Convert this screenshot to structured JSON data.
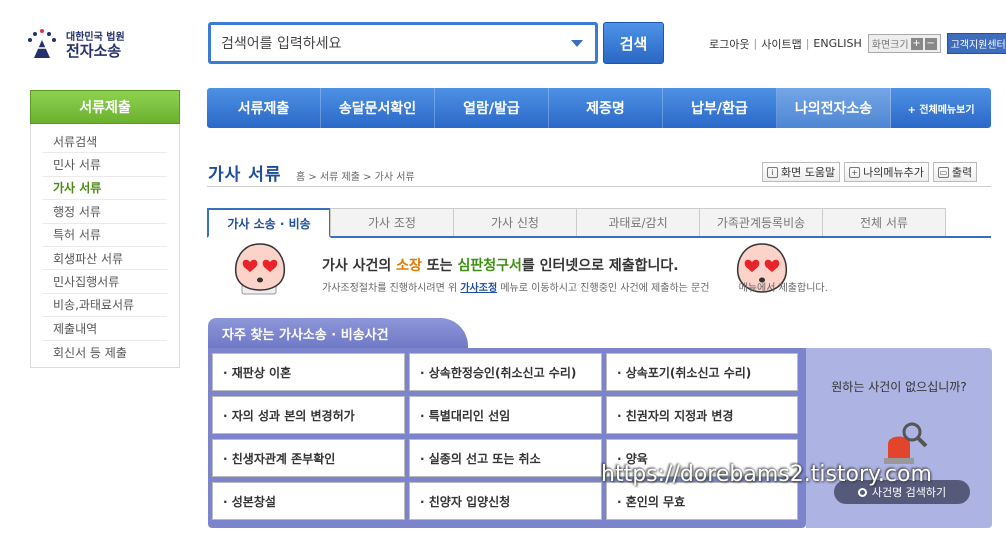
{
  "header": {
    "logo_small": "대한민국 법원",
    "logo_big": "전자소송",
    "search_placeholder": "검색어를 입력하세요",
    "search_button": "검색",
    "util": {
      "logout": "로그아웃",
      "sitemap": "사이트맵",
      "english": "ENGLISH",
      "font_size": "화면크기",
      "plus": "+",
      "minus": "−",
      "support": "고객지원센터"
    }
  },
  "sidebar": {
    "title": "서류제출",
    "items": [
      {
        "label": "서류검색"
      },
      {
        "label": "민사 서류"
      },
      {
        "label": "가사 서류"
      },
      {
        "label": "행정 서류"
      },
      {
        "label": "특허 서류"
      },
      {
        "label": "회생파산 서류"
      },
      {
        "label": "민사집행서류"
      },
      {
        "label": "비송,과태료서류"
      },
      {
        "label": "제출내역"
      },
      {
        "label": "회신서 등 제출"
      }
    ],
    "active_index": 2
  },
  "gnb": {
    "items": [
      "서류제출",
      "송달문서확인",
      "열람/발급",
      "제증명",
      "납부/환급",
      "나의전자소송"
    ],
    "all_menu": "+ 전체메뉴보기",
    "active_index": 5
  },
  "page": {
    "title": "가사 서류",
    "breadcrumb": "홈 > 서류 제출 > 가사 서류",
    "tools": {
      "help": "화면 도움말",
      "my_menu": "나의메뉴추가",
      "print": "출력"
    }
  },
  "tabs": {
    "items": [
      "가사 소송 · 비송",
      "가사 조정",
      "가사 신청",
      "과태료/감치",
      "가족관계등록비송",
      "전체 서류"
    ],
    "active_index": 0
  },
  "info": {
    "main_pre": "가사 사건의 ",
    "main_hl1": "소장",
    "main_mid": " 또는 ",
    "main_hl2": "심판청구서",
    "main_post": "를 인터넷으로 제출합니다.",
    "sub_pre": "가사조정절차를 진행하시려면 위 ",
    "sub_link": "가사조정",
    "sub_mid": " 메뉴로 이동하시고 진행중인 사건에 제출하는 문건",
    "sub_post": "메뉴에서 제출합니다."
  },
  "faq": {
    "title": "자주 찾는 가사소송 · 비송사건",
    "items": [
      "· 재판상 이혼",
      "· 상속한정승인(취소신고 수리)",
      "· 상속포기(취소신고 수리)",
      "· 자의 성과 본의 변경허가",
      "· 특별대리인 선임",
      "· 친권자의 지정과 변경",
      "· 친생자관계 존부확인",
      "· 실종의 선고 또는 취소",
      "· 양육",
      "· 성본창설",
      "· 친양자 입양신청",
      "· 혼인의 무효"
    ]
  },
  "help": {
    "question": "원하는 사건이 없으십니까?",
    "button": "사건명 검색하기"
  },
  "watermark": "https://dorebams2.tistory.com",
  "colors": {
    "primary_blue": "#2a69c8",
    "sidebar_green": "#6bb02e",
    "faq_purple": "#7c85cc",
    "highlight_orange": "#e07a00",
    "highlight_green": "#3e8e12"
  }
}
